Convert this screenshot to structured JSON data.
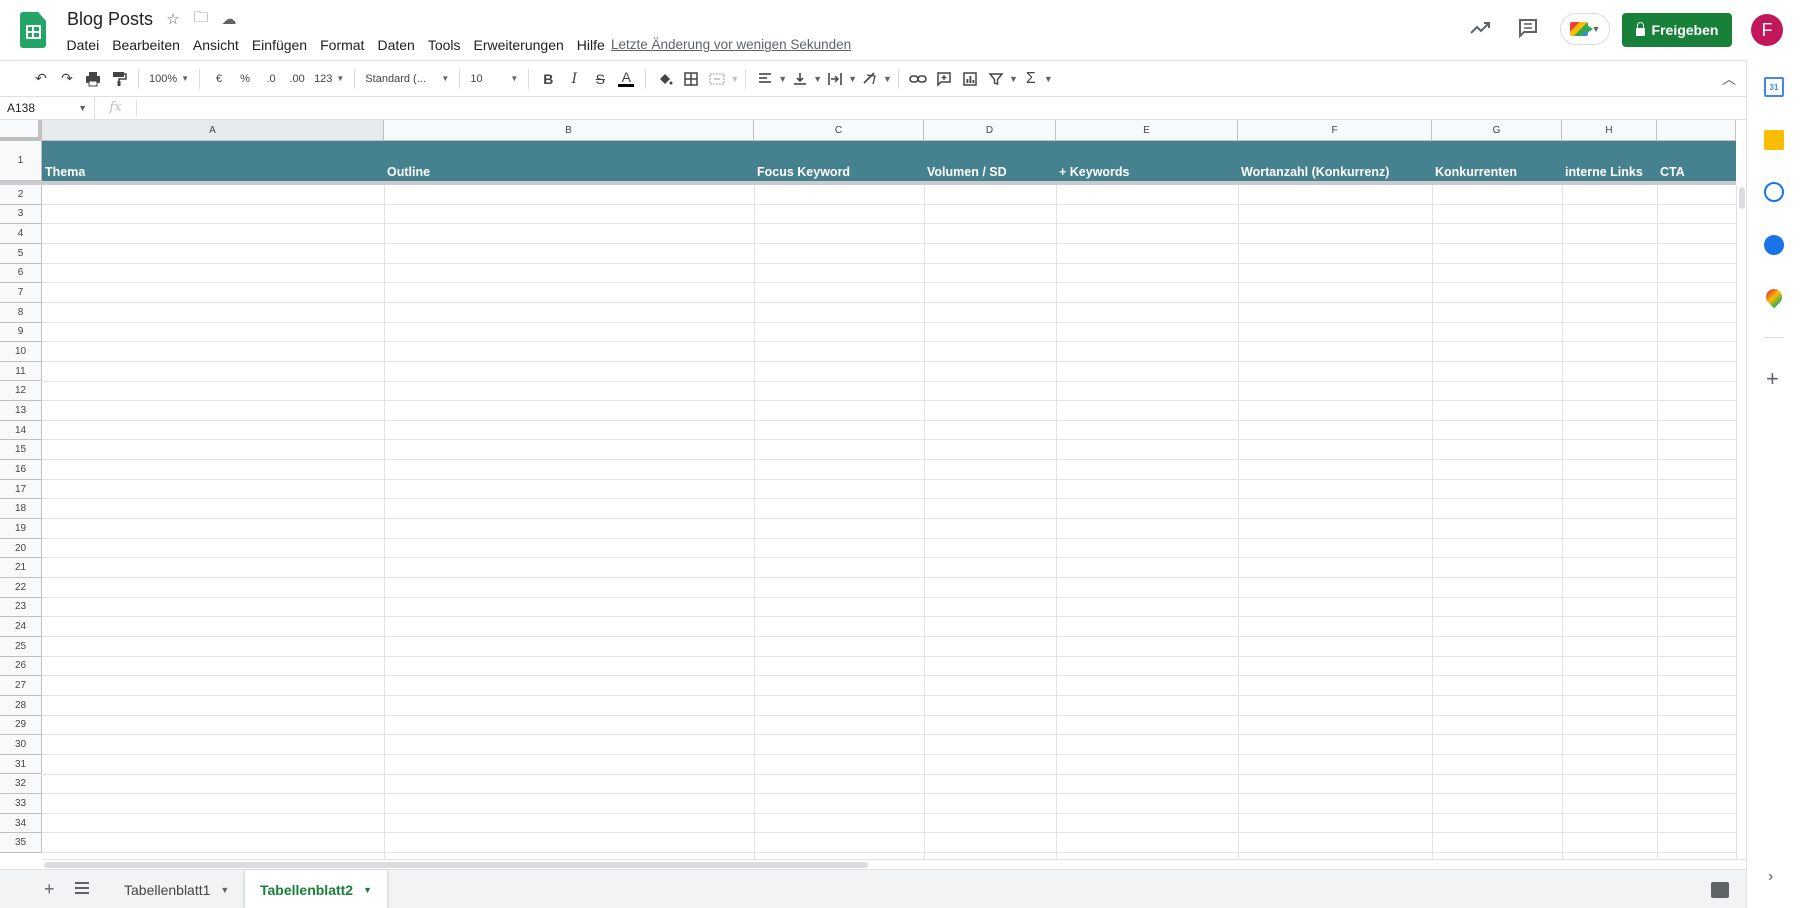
{
  "app": {
    "title": "Blog Posts",
    "last_change": "Letzte Änderung vor wenigen Sekunden",
    "share_label": "Freigeben",
    "avatar_initial": "F",
    "brand_color": "#188038",
    "header_fill": "#45818e"
  },
  "menu": [
    "Datei",
    "Bearbeiten",
    "Ansicht",
    "Einfügen",
    "Format",
    "Daten",
    "Tools",
    "Erweiterungen",
    "Hilfe"
  ],
  "toolbar": {
    "zoom": "100%",
    "currency": "€",
    "percent": "%",
    "dec_less": ".0",
    "dec_more": ".00",
    "number_format": "123",
    "font": "Standard (...",
    "font_size": "10",
    "icons": [
      "undo-icon",
      "redo-icon",
      "print-icon",
      "paint-format-icon",
      "bold-icon",
      "italic-icon",
      "strikethrough-icon",
      "text-color-icon",
      "fill-color-icon",
      "borders-icon",
      "merge-icon",
      "align-left-icon",
      "valign-bottom-icon",
      "wrap-icon",
      "rotate-icon",
      "link-icon",
      "comment-icon",
      "chart-icon",
      "filter-icon",
      "functions-icon"
    ]
  },
  "formula_bar": {
    "cell_ref": "A138",
    "fx": "fx",
    "value": ""
  },
  "columns": [
    "A",
    "B",
    "C",
    "D",
    "E",
    "F",
    "G",
    "H"
  ],
  "header_row": [
    "Thema",
    "Outline",
    "Focus Keyword",
    "Volumen / SD",
    "+ Keywords",
    "Wortanzahl (Konkurrenz)",
    "Konkurrenten",
    "interne Links",
    "CTA"
  ],
  "row_numbers": [
    "1",
    "2",
    "3",
    "4",
    "5",
    "6",
    "7",
    "8",
    "9",
    "10",
    "11",
    "12",
    "13",
    "14",
    "15",
    "16",
    "17",
    "18",
    "19",
    "20",
    "21",
    "22",
    "23",
    "24",
    "25",
    "26",
    "27",
    "28",
    "29",
    "30",
    "31",
    "32",
    "33",
    "34",
    "35"
  ],
  "sheets": [
    {
      "name": "Tabellenblatt1",
      "active": false
    },
    {
      "name": "Tabellenblatt2",
      "active": true
    }
  ],
  "side_panel": [
    "calendar-icon",
    "keep-icon",
    "tasks-icon",
    "contacts-icon",
    "maps-icon"
  ],
  "calendar_day": "31"
}
